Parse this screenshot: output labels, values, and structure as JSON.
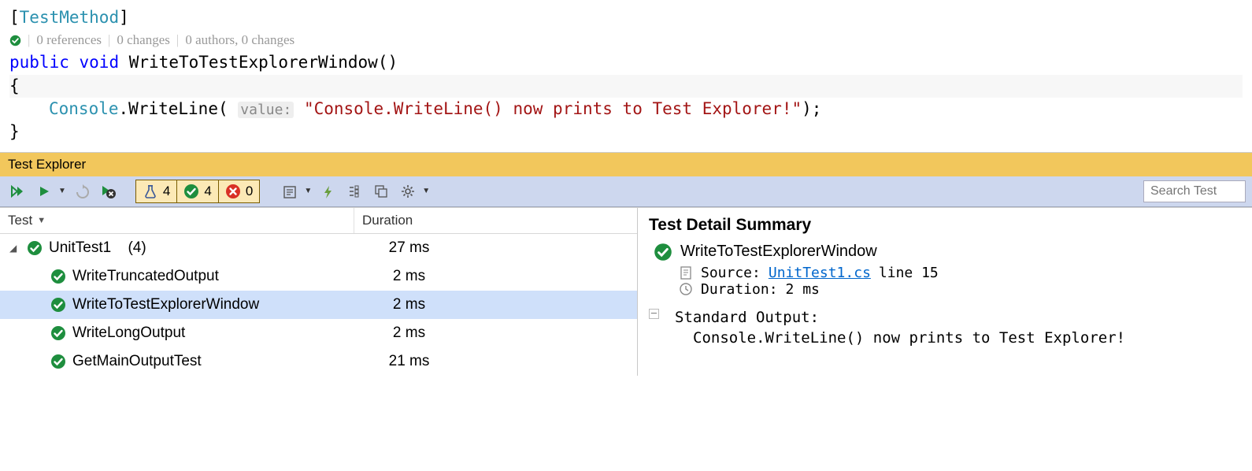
{
  "code": {
    "attribute": "TestMethod",
    "codelens": {
      "references": "0 references",
      "changes1": "0 changes",
      "authors": "0 authors, 0 changes"
    },
    "sig_kw1": "public",
    "sig_kw2": "void",
    "sig_name": "WriteToTestExplorerWindow",
    "console_type": "Console",
    "console_method": "WriteLine",
    "hint": "value:",
    "string_literal": "\"Console.WriteLine() now prints to Test Explorer!\""
  },
  "panel": {
    "title": "Test Explorer"
  },
  "counters": {
    "total": "4",
    "passed": "4",
    "failed": "0"
  },
  "search": {
    "placeholder": "Search Test"
  },
  "columns": {
    "name": "Test",
    "duration": "Duration"
  },
  "tree": {
    "group": {
      "label": "UnitTest1",
      "count": "(4)",
      "duration": "27 ms"
    },
    "tests": [
      {
        "name": "WriteTruncatedOutput",
        "duration": "2 ms",
        "selected": false
      },
      {
        "name": "WriteToTestExplorerWindow",
        "duration": "2 ms",
        "selected": true
      },
      {
        "name": "WriteLongOutput",
        "duration": "2 ms",
        "selected": false
      },
      {
        "name": "GetMainOutputTest",
        "duration": "21 ms",
        "selected": false
      }
    ]
  },
  "detail": {
    "title": "Test Detail Summary",
    "test_name": "WriteToTestExplorerWindow",
    "source_label": "Source:",
    "source_file": "UnitTest1.cs",
    "source_line": "line 15",
    "duration_label": "Duration:",
    "duration_value": "2 ms",
    "stdout_label": "Standard Output:",
    "stdout_text": "Console.WriteLine() now prints to Test Explorer!"
  }
}
